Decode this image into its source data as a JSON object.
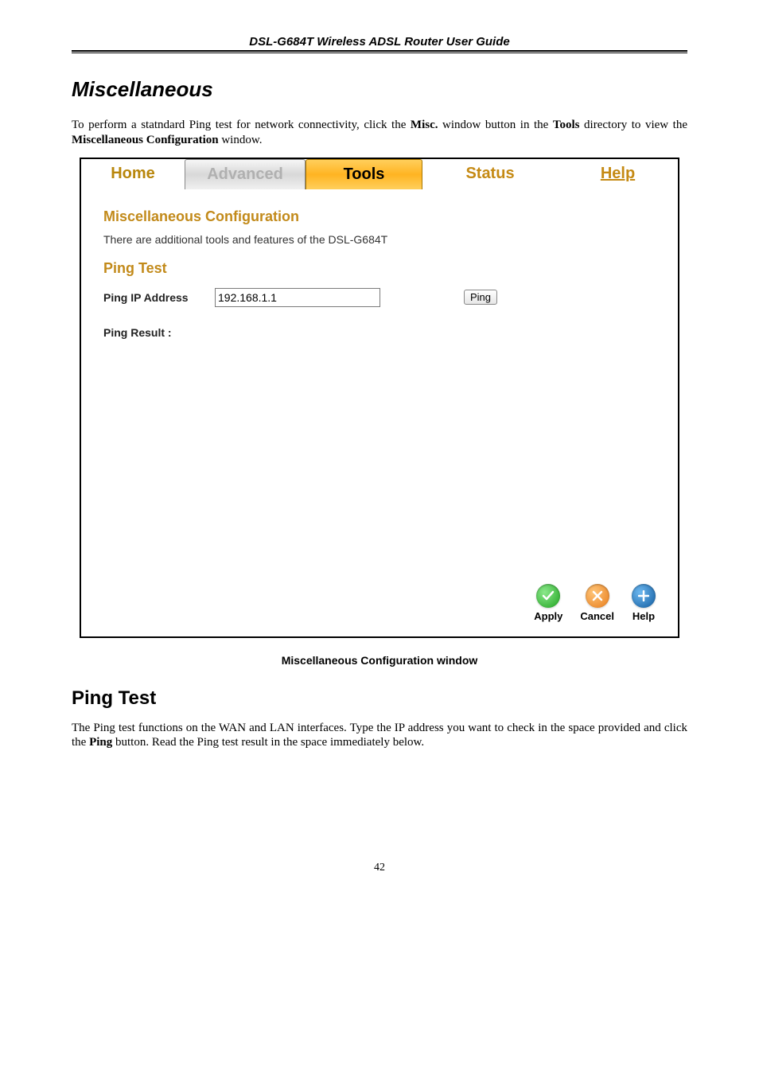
{
  "header": {
    "title": "DSL-G684T Wireless ADSL Router User Guide"
  },
  "section1": {
    "heading": "Miscellaneous",
    "paragraph_pre": "To perform a statndard Ping test for network connectivity, click the ",
    "paragraph_b1": "Misc.",
    "paragraph_mid1": " window button in the ",
    "paragraph_b2": "Tools",
    "paragraph_mid2": " directory to view the ",
    "paragraph_b3": "Miscellaneous Configuration",
    "paragraph_post": " window."
  },
  "screenshot": {
    "tabs": {
      "home": "Home",
      "advanced": "Advanced",
      "tools": "Tools",
      "status": "Status",
      "help": "Help"
    },
    "misc_config": "Miscellaneous Configuration",
    "misc_desc": "There are additional tools and features of the DSL-G684T",
    "ping_test": "Ping Test",
    "ping_ip_label": "Ping IP Address",
    "ping_ip_value": "192.168.1.1",
    "ping_button": "Ping",
    "ping_result": "Ping Result :",
    "footer": {
      "apply": "Apply",
      "cancel": "Cancel",
      "help": "Help"
    }
  },
  "caption": "Miscellaneous Configuration window",
  "section2": {
    "heading": "Ping Test",
    "paragraph_pre": "The Ping test functions on the WAN and LAN interfaces. Type the IP address you want to check in the space provided and click the ",
    "paragraph_b1": "Ping",
    "paragraph_post": " button. Read the Ping test result in the space immediately below."
  },
  "page_number": "42"
}
